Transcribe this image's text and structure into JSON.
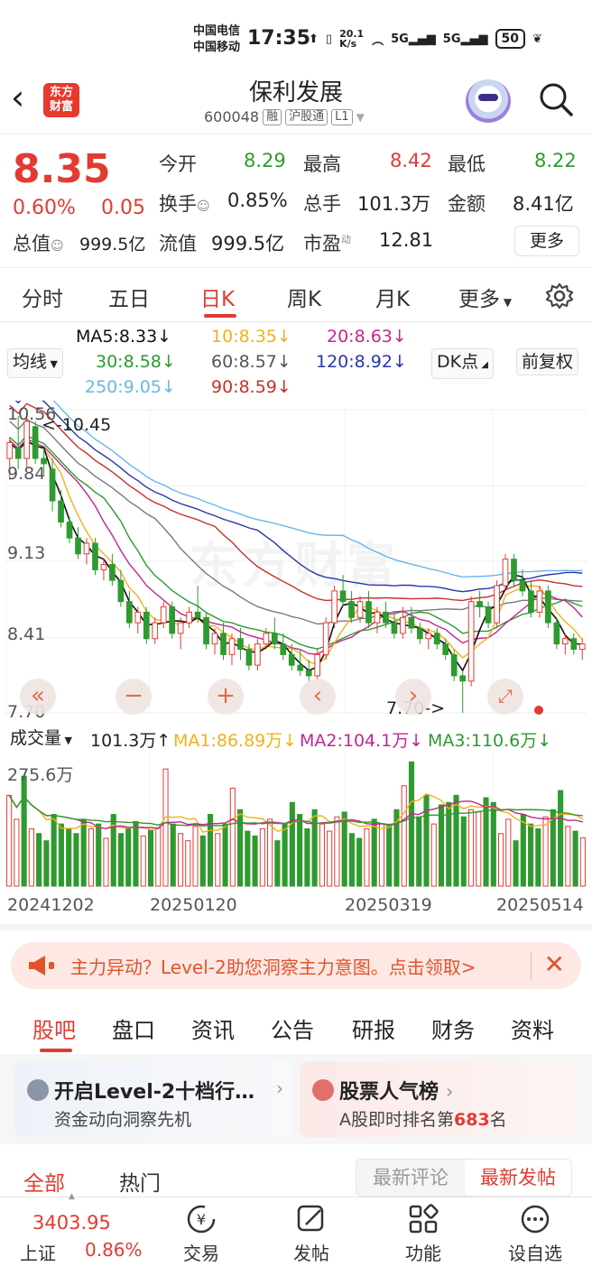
{
  "status_bar": {
    "carrier1": "中国电信",
    "carrier2": "中国移动",
    "time": "17:35",
    "speed": "20.1 K/s",
    "battery": "50"
  },
  "header": {
    "logo": "东方财富",
    "stock_name": "保利发展",
    "stock_code": "600048",
    "tags": [
      "融",
      "沪股通",
      "L1"
    ]
  },
  "quote": {
    "price": "8.35",
    "change_pct": "0.60%",
    "change": "0.05",
    "open_label": "今开",
    "open": "8.29",
    "high_label": "最高",
    "high": "8.42",
    "low_label": "最低",
    "low": "8.22",
    "turnover_label": "换手",
    "turnover": "0.85%",
    "volume_label": "总手",
    "volume": "101.3万",
    "amount_label": "金额",
    "amount": "8.41亿",
    "total_cap_label": "总值",
    "total_cap": "999.5亿",
    "float_cap_label": "流值",
    "float_cap": "999.5亿",
    "pe_label": "市盈",
    "pe_sup": "动",
    "pe": "12.81",
    "more": "更多"
  },
  "chart_tabs": {
    "items": [
      "分时",
      "五日",
      "日K",
      "周K",
      "月K",
      "更多"
    ],
    "active": "日K"
  },
  "ma_legend": {
    "selector": "均线",
    "ma5": "MA5:8.33↓",
    "ma10": "10:8.35↓",
    "ma20": "20:8.63↓",
    "ma30": "30:8.58↓",
    "ma60": "60:8.57↓",
    "ma120": "120:8.92↓",
    "ma250": "250:9.05↓",
    "ma90": "90:8.59↓",
    "dk": "DK点",
    "adjust": "前复权"
  },
  "colors": {
    "up": "#e23b32",
    "down": "#2f9a2f",
    "ma5": "#111111",
    "ma10": "#f0b21a",
    "ma20": "#c2278f",
    "ma30": "#2f9a2f",
    "ma60": "#7a7a7a",
    "ma120": "#2838a8",
    "ma250": "#69b6e8",
    "ma90": "#c8302a"
  },
  "chart_data": {
    "type": "candlestick",
    "y_labels": [
      "10.56",
      "9.84",
      "9.13",
      "8.41",
      "7.70"
    ],
    "ylim": [
      7.7,
      10.56
    ],
    "high_annotation": "<-10.45",
    "low_annotation": "7.70->",
    "x_labels": [
      "20241202",
      "20250120",
      "20250319",
      "20250514"
    ],
    "candles": [
      [
        10.1,
        10.3,
        9.9,
        10.25
      ],
      [
        10.2,
        10.5,
        10.0,
        10.1
      ],
      [
        10.1,
        10.56,
        10.0,
        10.45
      ],
      [
        10.4,
        10.45,
        10.05,
        10.1
      ],
      [
        10.1,
        10.2,
        9.95,
        10.05
      ],
      [
        10.0,
        10.1,
        9.6,
        9.7
      ],
      [
        9.7,
        9.8,
        9.45,
        9.5
      ],
      [
        9.5,
        9.55,
        9.3,
        9.35
      ],
      [
        9.35,
        9.45,
        9.15,
        9.2
      ],
      [
        9.2,
        9.35,
        9.1,
        9.3
      ],
      [
        9.3,
        9.35,
        9.0,
        9.05
      ],
      [
        9.05,
        9.15,
        8.95,
        9.1
      ],
      [
        9.1,
        9.2,
        8.9,
        8.95
      ],
      [
        8.95,
        9.05,
        8.7,
        8.75
      ],
      [
        8.75,
        8.85,
        8.5,
        8.55
      ],
      [
        8.55,
        8.7,
        8.45,
        8.65
      ],
      [
        8.65,
        8.7,
        8.35,
        8.4
      ],
      [
        8.4,
        8.6,
        8.35,
        8.55
      ],
      [
        8.55,
        8.75,
        8.5,
        8.7
      ],
      [
        8.7,
        8.75,
        8.4,
        8.45
      ],
      [
        8.45,
        8.6,
        8.3,
        8.55
      ],
      [
        8.55,
        8.7,
        8.5,
        8.65
      ],
      [
        8.65,
        8.9,
        8.55,
        8.6
      ],
      [
        8.6,
        8.65,
        8.3,
        8.35
      ],
      [
        8.35,
        8.5,
        8.25,
        8.45
      ],
      [
        8.45,
        8.55,
        8.2,
        8.25
      ],
      [
        8.25,
        8.45,
        8.15,
        8.4
      ],
      [
        8.4,
        8.5,
        8.2,
        8.3
      ],
      [
        8.3,
        8.35,
        8.1,
        8.15
      ],
      [
        8.15,
        8.4,
        8.1,
        8.35
      ],
      [
        8.35,
        8.5,
        8.3,
        8.45
      ],
      [
        8.45,
        8.6,
        8.3,
        8.35
      ],
      [
        8.35,
        8.45,
        8.2,
        8.25
      ],
      [
        8.25,
        8.35,
        8.1,
        8.15
      ],
      [
        8.15,
        8.3,
        8.05,
        8.1
      ],
      [
        8.1,
        8.2,
        8.0,
        8.05
      ],
      [
        8.05,
        8.3,
        8.0,
        8.25
      ],
      [
        8.25,
        8.6,
        8.2,
        8.55
      ],
      [
        8.55,
        8.9,
        8.5,
        8.85
      ],
      [
        8.85,
        9.0,
        8.7,
        8.75
      ],
      [
        8.75,
        8.85,
        8.55,
        8.6
      ],
      [
        8.6,
        8.8,
        8.55,
        8.75
      ],
      [
        8.75,
        8.85,
        8.5,
        8.55
      ],
      [
        8.55,
        8.7,
        8.45,
        8.65
      ],
      [
        8.65,
        8.75,
        8.5,
        8.55
      ],
      [
        8.55,
        8.65,
        8.4,
        8.45
      ],
      [
        8.45,
        8.7,
        8.4,
        8.6
      ],
      [
        8.6,
        8.7,
        8.45,
        8.5
      ],
      [
        8.5,
        8.55,
        8.35,
        8.4
      ],
      [
        8.4,
        8.5,
        8.3,
        8.45
      ],
      [
        8.45,
        8.5,
        8.3,
        8.35
      ],
      [
        8.35,
        8.4,
        8.2,
        8.25
      ],
      [
        8.25,
        8.3,
        8.0,
        8.05
      ],
      [
        8.05,
        8.1,
        7.7,
        8.0
      ],
      [
        8.0,
        8.8,
        7.95,
        8.75
      ],
      [
        8.75,
        8.85,
        8.6,
        8.7
      ],
      [
        8.7,
        8.75,
        8.5,
        8.55
      ],
      [
        8.55,
        8.95,
        8.5,
        8.9
      ],
      [
        8.9,
        9.2,
        8.85,
        9.15
      ],
      [
        9.15,
        9.2,
        8.9,
        8.95
      ],
      [
        8.95,
        9.05,
        8.8,
        8.85
      ],
      [
        8.85,
        8.95,
        8.6,
        8.65
      ],
      [
        8.65,
        8.9,
        8.6,
        8.85
      ],
      [
        8.85,
        8.9,
        8.5,
        8.55
      ],
      [
        8.55,
        8.6,
        8.3,
        8.35
      ],
      [
        8.35,
        8.45,
        8.25,
        8.4
      ],
      [
        8.4,
        8.45,
        8.25,
        8.3
      ],
      [
        8.3,
        8.4,
        8.2,
        8.35
      ]
    ],
    "ma_lines_note": "moving averages drawn from candle closes",
    "volume": {
      "max_label": "275.6万",
      "volume_label": "成交量",
      "current": "101.3万↑",
      "ma1": "MA1:86.89万↓",
      "ma2": "MA2:104.1万↓",
      "ma3": "MA3:110.6万↓",
      "max": 275.6,
      "values": [
        190,
        140,
        230,
        120,
        110,
        95,
        150,
        130,
        120,
        110,
        140,
        120,
        130,
        100,
        150,
        110,
        120,
        135,
        105,
        118,
        122,
        245,
        130,
        110,
        95,
        125,
        105,
        150,
        110,
        130,
        205,
        160,
        115,
        105,
        120,
        140,
        95,
        130,
        175,
        150,
        120,
        160,
        130,
        115,
        145,
        155,
        110,
        100,
        120,
        140,
        130,
        125,
        160,
        210,
        260,
        145,
        190,
        130,
        170,
        175,
        190,
        145,
        160,
        155,
        185,
        175,
        110,
        140,
        95,
        150,
        130,
        120,
        145,
        160,
        200,
        125,
        115,
        101
      ]
    }
  },
  "chart_controls": [
    "«",
    "−",
    "+",
    "‹",
    "›"
  ],
  "watermark": "东方财富",
  "promo": {
    "text": "主力异动？Level-2助您洞察主力意图。点击领取>"
  },
  "section_tabs": {
    "items": [
      "股吧",
      "盘口",
      "资讯",
      "公告",
      "研报",
      "财务",
      "资料"
    ],
    "active": "股吧"
  },
  "cards": [
    {
      "title": "开启Level-2十档行…",
      "sub": "资金动向洞察先机"
    },
    {
      "title": "股票人气榜",
      "sub_prefix": "A股即时排名第",
      "rank": "683",
      "sub_suffix": "名"
    }
  ],
  "feed_tabs": {
    "items": [
      "全部",
      "热门"
    ],
    "active": "全部",
    "sort": [
      "最新评论",
      "最新发帖"
    ],
    "sort_active": "最新发帖"
  },
  "bottom_bar": {
    "index_value": "3403.95",
    "index_name": "上证",
    "index_pct": "0.86%",
    "nav": [
      "交易",
      "发帖",
      "功能",
      "设自选"
    ]
  }
}
